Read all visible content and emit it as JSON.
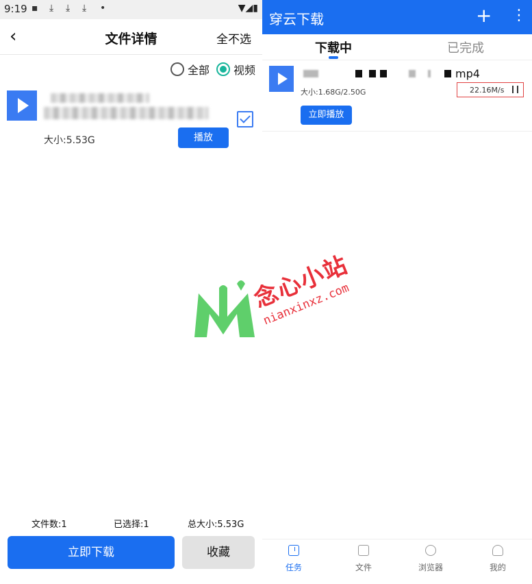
{
  "left": {
    "status": {
      "time": "9:19"
    },
    "header": {
      "title": "文件详情",
      "deselect_label": "全不选"
    },
    "filters": {
      "all_label": "全部",
      "video_label": "视频",
      "selected": "视频"
    },
    "file": {
      "size_label": "大小:5.53G",
      "play_label": "播放",
      "checked": true
    },
    "summary": {
      "file_count": "文件数:1",
      "selected_count": "已选择:1",
      "total_size": "总大小:5.53G"
    },
    "actions": {
      "download_label": "立即下载",
      "favorite_label": "收藏"
    }
  },
  "right": {
    "header": {
      "title": "穿云下载"
    },
    "tabs": [
      {
        "label": "下载中",
        "active": true
      },
      {
        "label": "已完成",
        "active": false
      }
    ],
    "task": {
      "name_ext": "mp4",
      "size_progress": "大小:1.68G/2.50G",
      "speed": "22.16M/s",
      "play_now_label": "立即播放"
    },
    "nav": [
      {
        "label": "任务",
        "icon": "download-icon",
        "active": true
      },
      {
        "label": "文件",
        "icon": "folder-icon",
        "active": false
      },
      {
        "label": "浏览器",
        "icon": "globe-icon",
        "active": false
      },
      {
        "label": "我的",
        "icon": "person-icon",
        "active": false
      }
    ]
  },
  "watermark": {
    "brand": "念心小站",
    "url": "nianxinxz.com"
  },
  "colors": {
    "accent": "#1a6ef0",
    "radio_on": "#17b59b",
    "highlight_box": "#e04040",
    "watermark": "#e8303a"
  }
}
